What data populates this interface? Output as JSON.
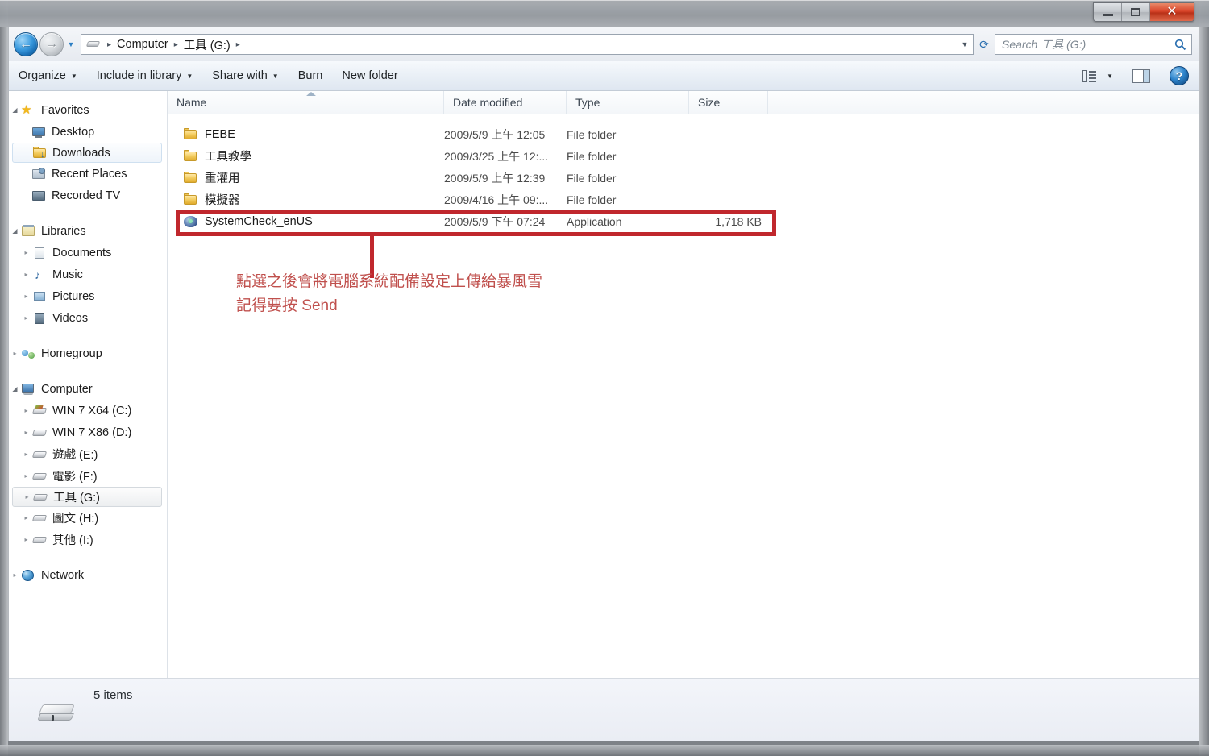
{
  "window": {
    "controls": {
      "minimize_label": "Minimize",
      "maximize_label": "Maximize",
      "close_label": "Close"
    }
  },
  "addressbar": {
    "back_label": "Back",
    "forward_label": "Forward",
    "history_label": "Recent pages",
    "refresh_label": "Refresh",
    "breadcrumb": {
      "root_icon": "drive-icon",
      "items": [
        "Computer",
        "工具 (G:)"
      ],
      "separator": "▸"
    },
    "search": {
      "placeholder": "Search 工具 (G:)",
      "icon": "search-icon"
    }
  },
  "toolbar": {
    "items": [
      {
        "label": "Organize",
        "has_caret": true
      },
      {
        "label": "Include in library",
        "has_caret": true
      },
      {
        "label": "Share with",
        "has_caret": true
      },
      {
        "label": "Burn",
        "has_caret": false
      },
      {
        "label": "New folder",
        "has_caret": false
      }
    ],
    "view_mode_icon": "list-view-icon",
    "view_mode_caret": "▼",
    "preview_pane_icon": "preview-pane-icon",
    "help_icon": "help-icon",
    "help_glyph": "?"
  },
  "sidebar": {
    "groups": [
      {
        "name": "favorites",
        "header": {
          "label": "Favorites",
          "icon": "star-icon",
          "expander": "◢",
          "expanded": true
        },
        "items": [
          {
            "label": "Desktop",
            "icon": "desktop-icon",
            "state": "normal",
            "expander": ""
          },
          {
            "label": "Downloads",
            "icon": "downloads-folder-icon",
            "state": "hovered",
            "expander": ""
          },
          {
            "label": "Recent Places",
            "icon": "recent-places-icon",
            "state": "normal",
            "expander": ""
          },
          {
            "label": "Recorded TV",
            "icon": "recorded-tv-icon",
            "state": "normal",
            "expander": ""
          }
        ]
      },
      {
        "name": "libraries",
        "header": {
          "label": "Libraries",
          "icon": "libraries-icon",
          "expander": "◢",
          "expanded": true
        },
        "items": [
          {
            "label": "Documents",
            "icon": "documents-icon",
            "state": "normal",
            "expander": "▸"
          },
          {
            "label": "Music",
            "icon": "music-icon",
            "state": "normal",
            "expander": "▸"
          },
          {
            "label": "Pictures",
            "icon": "pictures-icon",
            "state": "normal",
            "expander": "▸"
          },
          {
            "label": "Videos",
            "icon": "videos-icon",
            "state": "normal",
            "expander": "▸"
          }
        ]
      },
      {
        "name": "homegroup",
        "header": {
          "label": "Homegroup",
          "icon": "homegroup-icon",
          "expander": "▸",
          "expanded": false
        },
        "items": []
      },
      {
        "name": "computer",
        "header": {
          "label": "Computer",
          "icon": "computer-icon",
          "expander": "◢",
          "expanded": true
        },
        "items": [
          {
            "label": "WIN 7 X64 (C:)",
            "icon": "windows-drive-icon",
            "state": "normal",
            "expander": "▸"
          },
          {
            "label": "WIN 7 X86 (D:)",
            "icon": "drive-icon",
            "state": "normal",
            "expander": "▸"
          },
          {
            "label": "遊戲 (E:)",
            "icon": "drive-icon",
            "state": "normal",
            "expander": "▸"
          },
          {
            "label": "電影 (F:)",
            "icon": "drive-icon",
            "state": "normal",
            "expander": "▸"
          },
          {
            "label": "工具 (G:)",
            "icon": "drive-icon",
            "state": "selected",
            "expander": "▸"
          },
          {
            "label": "圖文 (H:)",
            "icon": "drive-icon",
            "state": "normal",
            "expander": "▸"
          },
          {
            "label": "其他 (I:)",
            "icon": "drive-icon",
            "state": "normal",
            "expander": "▸"
          }
        ]
      },
      {
        "name": "network",
        "header": {
          "label": "Network",
          "icon": "network-icon",
          "expander": "▸",
          "expanded": false
        },
        "items": []
      }
    ]
  },
  "filelist": {
    "columns": [
      {
        "key": "name",
        "label": "Name",
        "sorted": "asc"
      },
      {
        "key": "date",
        "label": "Date modified",
        "sorted": ""
      },
      {
        "key": "type",
        "label": "Type",
        "sorted": ""
      },
      {
        "key": "size",
        "label": "Size",
        "sorted": ""
      }
    ],
    "rows": [
      {
        "name": "FEBE",
        "date": "2009/5/9 上午 12:05",
        "type": "File folder",
        "size": "",
        "icon": "folder-icon"
      },
      {
        "name": "工具教學",
        "date": "2009/3/25 上午 12:...",
        "type": "File folder",
        "size": "",
        "icon": "folder-icon"
      },
      {
        "name": "重灌用",
        "date": "2009/5/9 上午 12:39",
        "type": "File folder",
        "size": "",
        "icon": "folder-icon"
      },
      {
        "name": "模擬器",
        "date": "2009/4/16 上午 09:...",
        "type": "File folder",
        "size": "",
        "icon": "folder-icon"
      },
      {
        "name": "SystemCheck_enUS",
        "date": "2009/5/9 下午 07:24",
        "type": "Application",
        "size": "1,718 KB",
        "icon": "application-icon"
      }
    ]
  },
  "annotation": {
    "highlight_color": "#c0272d",
    "text_color": "#c0504d",
    "line1": "點選之後會將電腦系統配備設定上傳給暴風雪",
    "line2": "記得要按 Send"
  },
  "statusbar": {
    "item_count_text": "5 items",
    "icon": "drive-icon"
  }
}
